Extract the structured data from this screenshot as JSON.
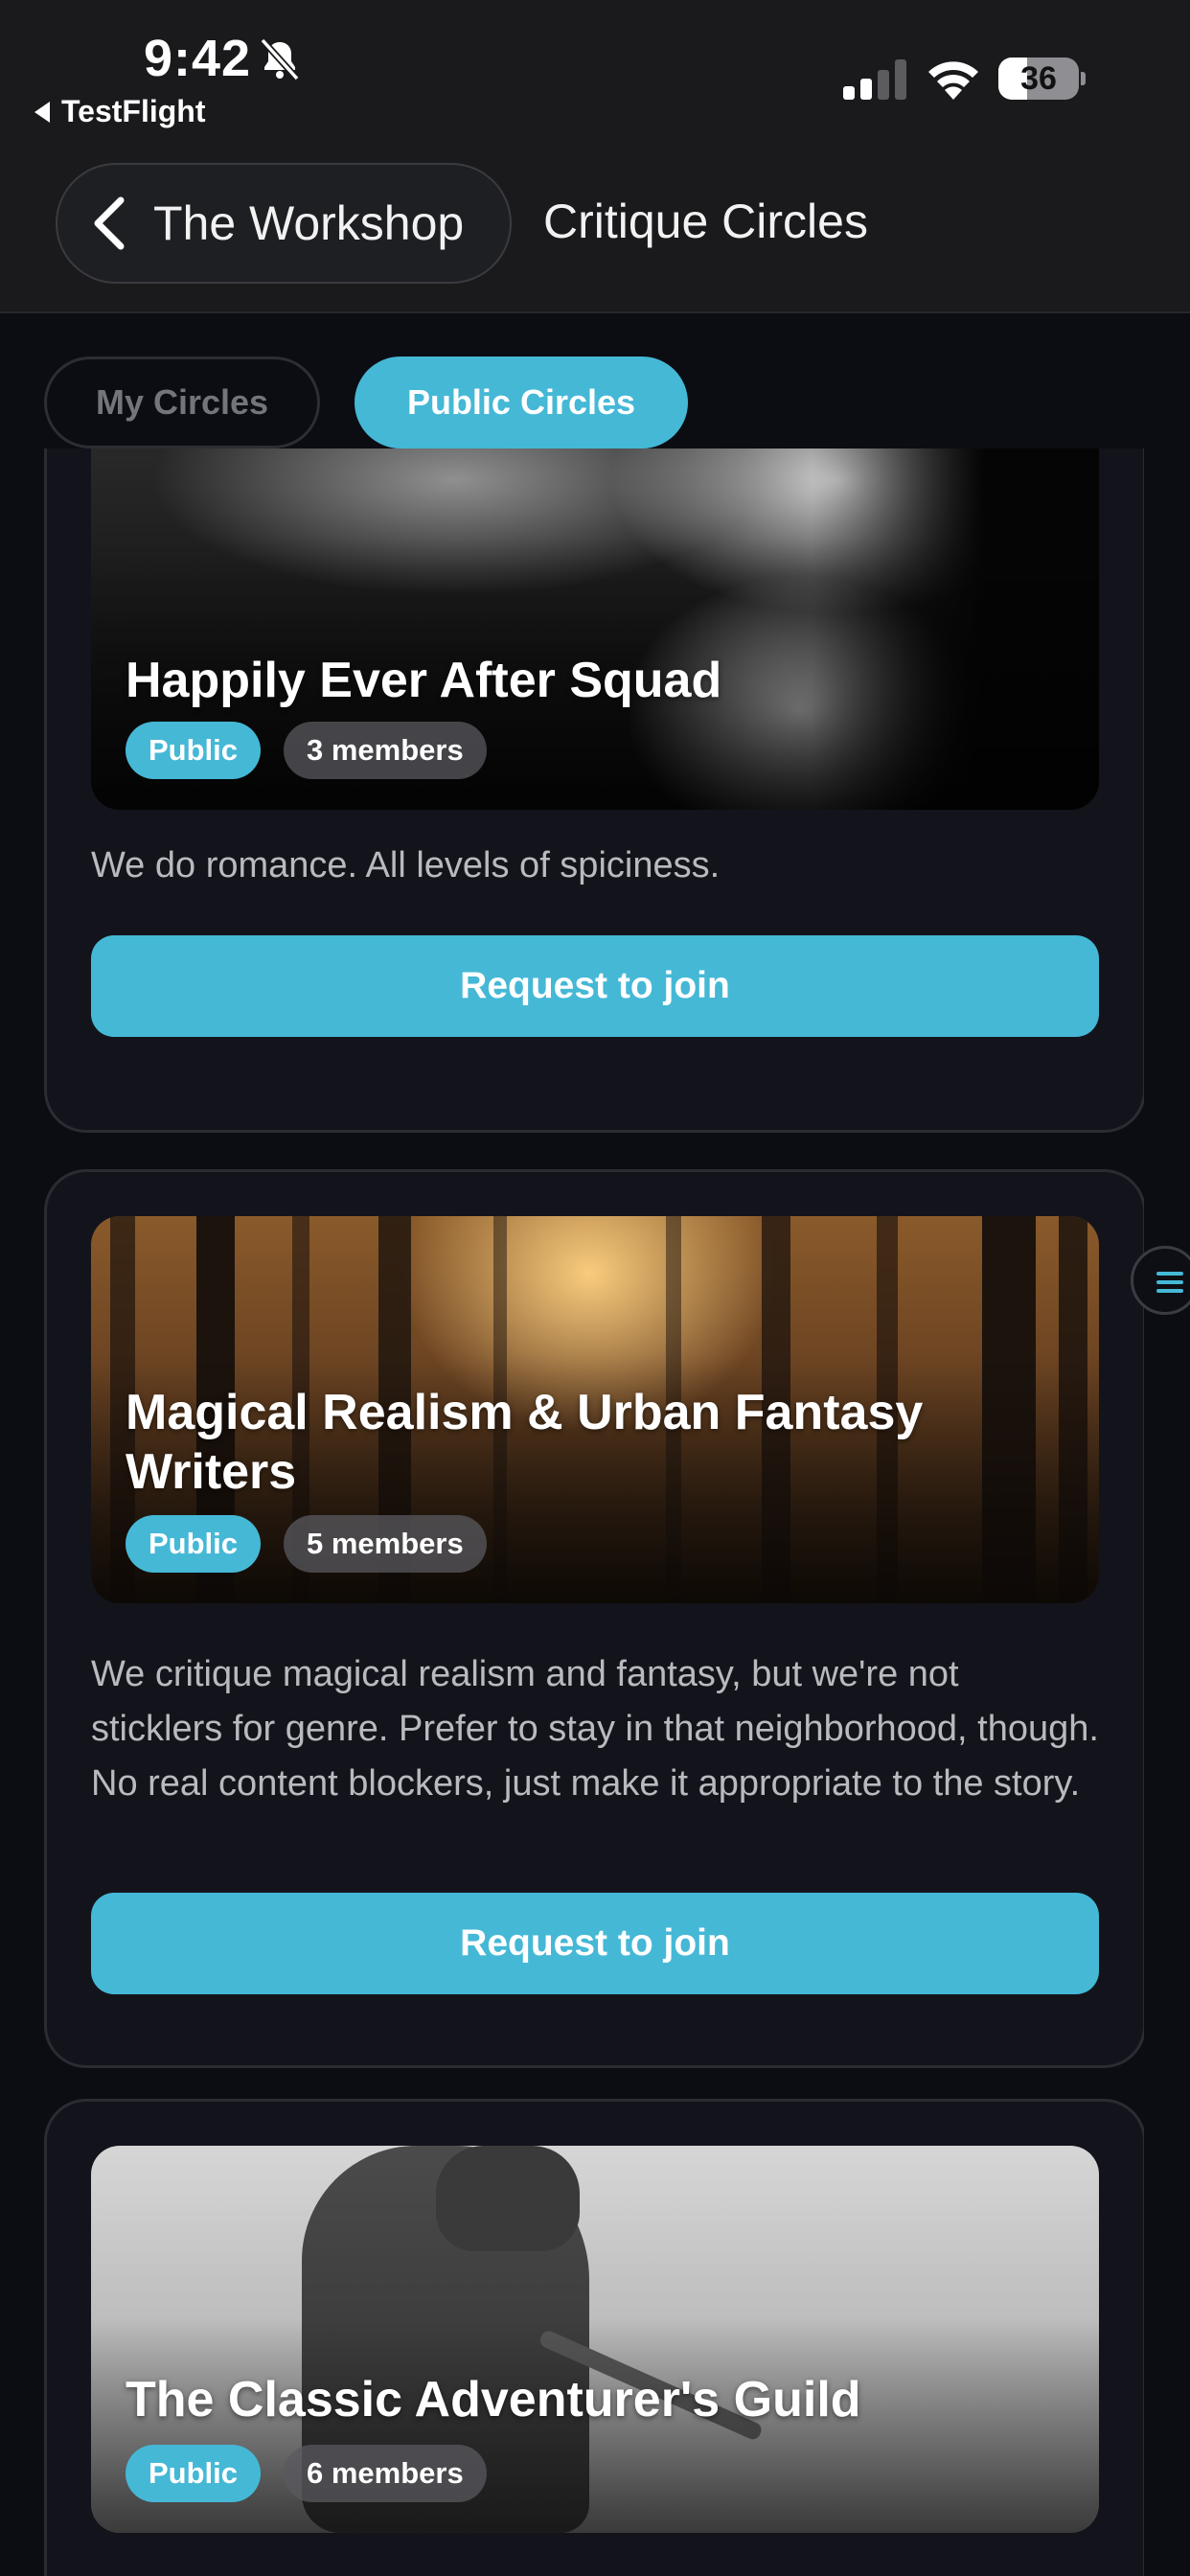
{
  "status_bar": {
    "time": "9:42",
    "back_app": "TestFlight",
    "battery_level": "36",
    "battery_fraction": 0.36
  },
  "nav": {
    "back_label": "The Workshop",
    "title": "Critique Circles"
  },
  "tabs": [
    {
      "label": "My Circles",
      "active": false
    },
    {
      "label": "Public Circles",
      "active": true
    }
  ],
  "circles": [
    {
      "title": "Happily Ever After Squad",
      "visibility": "Public",
      "members": "3 members",
      "description": "We do romance. All levels of spiciness.",
      "button": "Request to join"
    },
    {
      "title": "Magical Realism & Urban Fantasy Writers",
      "visibility": "Public",
      "members": "5 members",
      "description": "We critique magical realism and fantasy, but we're not sticklers for genre. Prefer to stay in that neighborhood, though. No real content blockers, just make it appropriate to the story.",
      "button": "Request to join"
    },
    {
      "title": "The Classic Adventurer's Guild",
      "visibility": "Public",
      "members": "6 members"
    }
  ],
  "colors": {
    "accent": "#45b8d6",
    "background": "#0c0d13",
    "card": "#13141b",
    "topbar": "#1a1a1c"
  }
}
